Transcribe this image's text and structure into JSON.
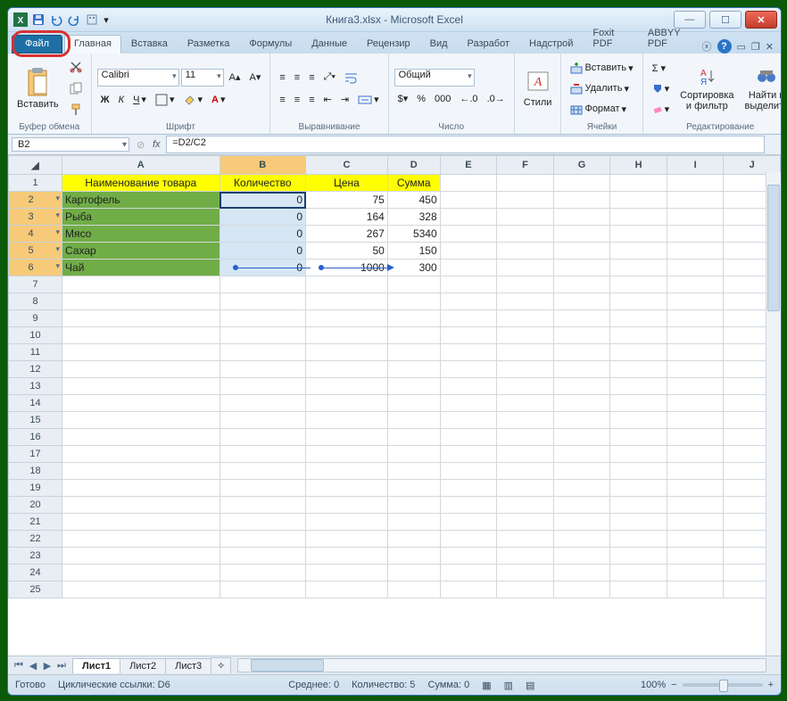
{
  "title": "Книга3.xlsx - Microsoft Excel",
  "tabs": {
    "file": "Файл",
    "home": "Главная",
    "insert": "Вставка",
    "layout": "Разметка",
    "formulas": "Формулы",
    "data": "Данные",
    "review": "Рецензир",
    "view": "Вид",
    "developer": "Разработ",
    "addins": "Надстрой",
    "foxit": "Foxit PDF",
    "abbyy": "ABBYY PDF"
  },
  "ribbon": {
    "clipboard": {
      "paste": "Вставить",
      "label": "Буфер обмена"
    },
    "font": {
      "name": "Calibri",
      "size": "11",
      "label": "Шрифт"
    },
    "align": {
      "label": "Выравнивание"
    },
    "number": {
      "format": "Общий",
      "label": "Число"
    },
    "styles": {
      "btn": "Стили",
      "label": ""
    },
    "cells": {
      "insert": "Вставить",
      "delete": "Удалить",
      "format": "Формат",
      "label": "Ячейки"
    },
    "editing": {
      "sort": "Сортировка\nи фильтр",
      "find": "Найти и\nвыделить",
      "label": "Редактирование"
    }
  },
  "formula_bar": {
    "name": "B2",
    "formula": "=D2/C2"
  },
  "cols": [
    "A",
    "B",
    "C",
    "D",
    "E",
    "F",
    "G",
    "H",
    "I",
    "J"
  ],
  "headers": {
    "a": "Наименование товара",
    "b": "Количество",
    "c": "Цена",
    "d": "Сумма"
  },
  "rows": [
    {
      "a": "Картофель",
      "b": "0",
      "c": "75",
      "d": "450"
    },
    {
      "a": "Рыба",
      "b": "0",
      "c": "164",
      "d": "328"
    },
    {
      "a": "Мясо",
      "b": "0",
      "c": "267",
      "d": "5340"
    },
    {
      "a": "Сахар",
      "b": "0",
      "c": "50",
      "d": "150"
    },
    {
      "a": "Чай",
      "b": "0",
      "c": "1000",
      "d": "300"
    }
  ],
  "sheets": {
    "s1": "Лист1",
    "s2": "Лист2",
    "s3": "Лист3"
  },
  "status": {
    "ready": "Готово",
    "circular": "Циклические ссылки: D6",
    "avg": "Среднее: 0",
    "count": "Количество: 5",
    "sum": "Сумма: 0",
    "zoom": "100%"
  }
}
